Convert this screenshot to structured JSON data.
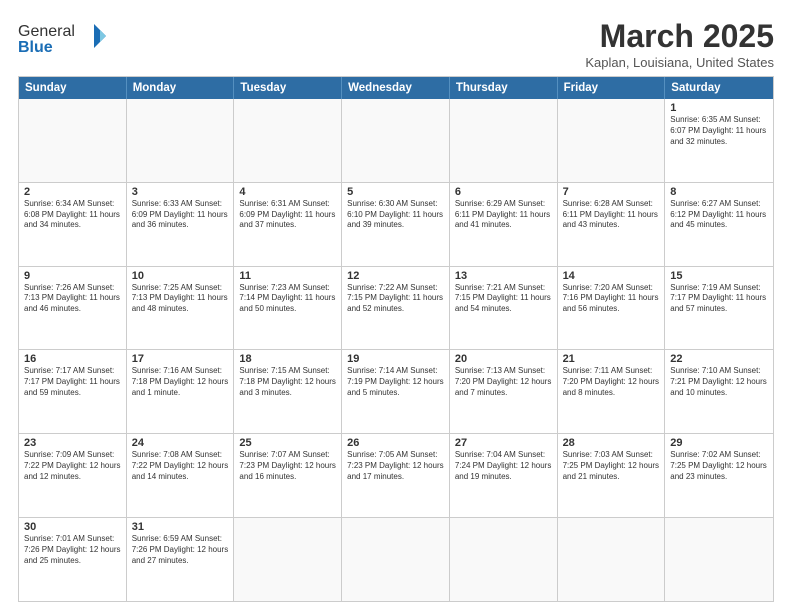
{
  "header": {
    "logo_general": "General",
    "logo_blue": "Blue",
    "title": "March 2025",
    "subtitle": "Kaplan, Louisiana, United States"
  },
  "days_of_week": [
    "Sunday",
    "Monday",
    "Tuesday",
    "Wednesday",
    "Thursday",
    "Friday",
    "Saturday"
  ],
  "rows": [
    [
      {
        "day": "",
        "text": ""
      },
      {
        "day": "",
        "text": ""
      },
      {
        "day": "",
        "text": ""
      },
      {
        "day": "",
        "text": ""
      },
      {
        "day": "",
        "text": ""
      },
      {
        "day": "",
        "text": ""
      },
      {
        "day": "1",
        "text": "Sunrise: 6:35 AM\nSunset: 6:07 PM\nDaylight: 11 hours\nand 32 minutes."
      }
    ],
    [
      {
        "day": "2",
        "text": "Sunrise: 6:34 AM\nSunset: 6:08 PM\nDaylight: 11 hours\nand 34 minutes."
      },
      {
        "day": "3",
        "text": "Sunrise: 6:33 AM\nSunset: 6:09 PM\nDaylight: 11 hours\nand 36 minutes."
      },
      {
        "day": "4",
        "text": "Sunrise: 6:31 AM\nSunset: 6:09 PM\nDaylight: 11 hours\nand 37 minutes."
      },
      {
        "day": "5",
        "text": "Sunrise: 6:30 AM\nSunset: 6:10 PM\nDaylight: 11 hours\nand 39 minutes."
      },
      {
        "day": "6",
        "text": "Sunrise: 6:29 AM\nSunset: 6:11 PM\nDaylight: 11 hours\nand 41 minutes."
      },
      {
        "day": "7",
        "text": "Sunrise: 6:28 AM\nSunset: 6:11 PM\nDaylight: 11 hours\nand 43 minutes."
      },
      {
        "day": "8",
        "text": "Sunrise: 6:27 AM\nSunset: 6:12 PM\nDaylight: 11 hours\nand 45 minutes."
      }
    ],
    [
      {
        "day": "9",
        "text": "Sunrise: 7:26 AM\nSunset: 7:13 PM\nDaylight: 11 hours\nand 46 minutes."
      },
      {
        "day": "10",
        "text": "Sunrise: 7:25 AM\nSunset: 7:13 PM\nDaylight: 11 hours\nand 48 minutes."
      },
      {
        "day": "11",
        "text": "Sunrise: 7:23 AM\nSunset: 7:14 PM\nDaylight: 11 hours\nand 50 minutes."
      },
      {
        "day": "12",
        "text": "Sunrise: 7:22 AM\nSunset: 7:15 PM\nDaylight: 11 hours\nand 52 minutes."
      },
      {
        "day": "13",
        "text": "Sunrise: 7:21 AM\nSunset: 7:15 PM\nDaylight: 11 hours\nand 54 minutes."
      },
      {
        "day": "14",
        "text": "Sunrise: 7:20 AM\nSunset: 7:16 PM\nDaylight: 11 hours\nand 56 minutes."
      },
      {
        "day": "15",
        "text": "Sunrise: 7:19 AM\nSunset: 7:17 PM\nDaylight: 11 hours\nand 57 minutes."
      }
    ],
    [
      {
        "day": "16",
        "text": "Sunrise: 7:17 AM\nSunset: 7:17 PM\nDaylight: 11 hours\nand 59 minutes."
      },
      {
        "day": "17",
        "text": "Sunrise: 7:16 AM\nSunset: 7:18 PM\nDaylight: 12 hours\nand 1 minute."
      },
      {
        "day": "18",
        "text": "Sunrise: 7:15 AM\nSunset: 7:18 PM\nDaylight: 12 hours\nand 3 minutes."
      },
      {
        "day": "19",
        "text": "Sunrise: 7:14 AM\nSunset: 7:19 PM\nDaylight: 12 hours\nand 5 minutes."
      },
      {
        "day": "20",
        "text": "Sunrise: 7:13 AM\nSunset: 7:20 PM\nDaylight: 12 hours\nand 7 minutes."
      },
      {
        "day": "21",
        "text": "Sunrise: 7:11 AM\nSunset: 7:20 PM\nDaylight: 12 hours\nand 8 minutes."
      },
      {
        "day": "22",
        "text": "Sunrise: 7:10 AM\nSunset: 7:21 PM\nDaylight: 12 hours\nand 10 minutes."
      }
    ],
    [
      {
        "day": "23",
        "text": "Sunrise: 7:09 AM\nSunset: 7:22 PM\nDaylight: 12 hours\nand 12 minutes."
      },
      {
        "day": "24",
        "text": "Sunrise: 7:08 AM\nSunset: 7:22 PM\nDaylight: 12 hours\nand 14 minutes."
      },
      {
        "day": "25",
        "text": "Sunrise: 7:07 AM\nSunset: 7:23 PM\nDaylight: 12 hours\nand 16 minutes."
      },
      {
        "day": "26",
        "text": "Sunrise: 7:05 AM\nSunset: 7:23 PM\nDaylight: 12 hours\nand 17 minutes."
      },
      {
        "day": "27",
        "text": "Sunrise: 7:04 AM\nSunset: 7:24 PM\nDaylight: 12 hours\nand 19 minutes."
      },
      {
        "day": "28",
        "text": "Sunrise: 7:03 AM\nSunset: 7:25 PM\nDaylight: 12 hours\nand 21 minutes."
      },
      {
        "day": "29",
        "text": "Sunrise: 7:02 AM\nSunset: 7:25 PM\nDaylight: 12 hours\nand 23 minutes."
      }
    ],
    [
      {
        "day": "30",
        "text": "Sunrise: 7:01 AM\nSunset: 7:26 PM\nDaylight: 12 hours\nand 25 minutes."
      },
      {
        "day": "31",
        "text": "Sunrise: 6:59 AM\nSunset: 7:26 PM\nDaylight: 12 hours\nand 27 minutes."
      },
      {
        "day": "",
        "text": ""
      },
      {
        "day": "",
        "text": ""
      },
      {
        "day": "",
        "text": ""
      },
      {
        "day": "",
        "text": ""
      },
      {
        "day": "",
        "text": ""
      }
    ]
  ]
}
